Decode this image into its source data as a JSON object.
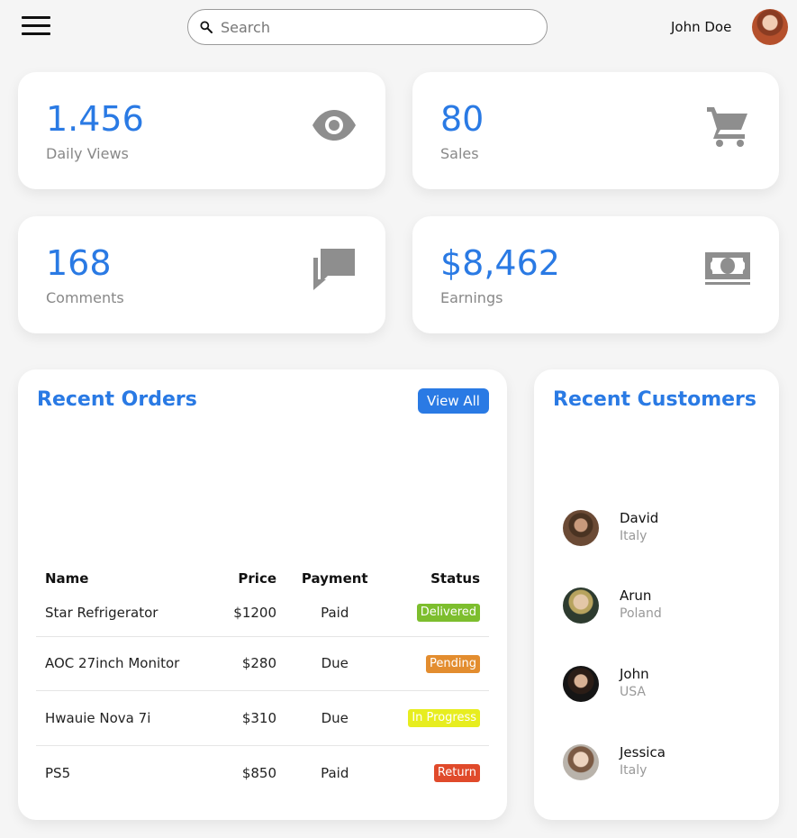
{
  "header": {
    "search_placeholder": "Search",
    "user_name": "John Doe"
  },
  "stats": [
    {
      "value": "1.456",
      "label": "Daily Views",
      "icon": "eye-icon"
    },
    {
      "value": "80",
      "label": "Sales",
      "icon": "cart-icon"
    },
    {
      "value": "168",
      "label": "Comments",
      "icon": "chat-icon"
    },
    {
      "value": "$8,462",
      "label": "Earnings",
      "icon": "money-icon"
    }
  ],
  "orders": {
    "title": "Recent Orders",
    "view_all": "View All",
    "columns": [
      "Name",
      "Price",
      "Payment",
      "Status"
    ],
    "rows": [
      {
        "name": "Star Refrigerator",
        "price": "$1200",
        "payment": "Paid",
        "status": "Delivered",
        "status_color": "#7dbe2e"
      },
      {
        "name": "AOC 27inch Monitor",
        "price": "$280",
        "payment": "Due",
        "status": "Pending",
        "status_color": "#e38d2f"
      },
      {
        "name": "Hwauie Nova 7i",
        "price": "$310",
        "payment": "Due",
        "status": "In Progress",
        "status_color": "#e7ed1f"
      },
      {
        "name": "PS5",
        "price": "$850",
        "payment": "Paid",
        "status": "Return",
        "status_color": "#e04a2b"
      }
    ]
  },
  "customers": {
    "title": "Recent Customers",
    "items": [
      {
        "name": "David",
        "country": "Italy"
      },
      {
        "name": "Arun",
        "country": "Poland"
      },
      {
        "name": "John",
        "country": "USA"
      },
      {
        "name": "Jessica",
        "country": "Italy"
      }
    ]
  },
  "colors": {
    "accent": "#2a7ae4",
    "icon_gray": "#8e8e8e"
  }
}
